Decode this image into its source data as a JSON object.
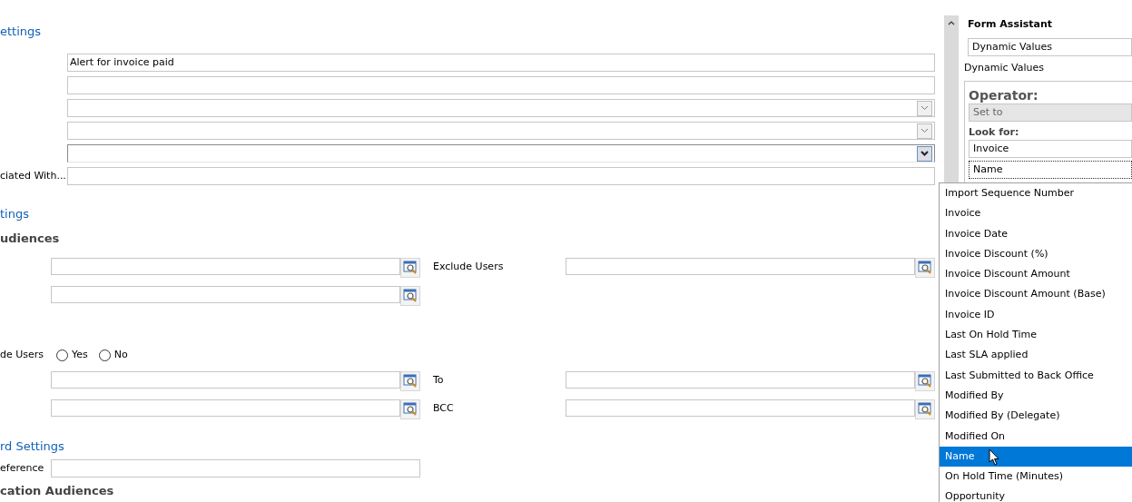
{
  "general": {
    "heading": "ettings",
    "fields": [
      {
        "kind": "text",
        "value": "Alert for invoice paid",
        "focused": false
      },
      {
        "kind": "text",
        "focused": false
      },
      {
        "kind": "select",
        "focused": false
      },
      {
        "kind": "select",
        "focused": false
      },
      {
        "kind": "select",
        "focused": true
      },
      {
        "kind": "text",
        "label": "ciated With...",
        "focused": false
      }
    ]
  },
  "audience_settings": {
    "heading": "tings",
    "subheading": "udiences",
    "lookup_rows": [
      {
        "kind": "double",
        "right_label": "Exclude Users"
      },
      {
        "kind": "single"
      }
    ]
  },
  "include_users": {
    "label": "de Users",
    "options": [
      {
        "label": "Yes",
        "selected": false
      },
      {
        "label": "No",
        "selected": false
      }
    ]
  },
  "recipient_rows": [
    {
      "kind": "double",
      "right_label": "To"
    },
    {
      "kind": "double",
      "right_label": "BCC"
    }
  ],
  "dashboard_settings": {
    "heading": "rd Settings",
    "reference_label": "eference"
  },
  "next_heading": "cation Audiences",
  "form_assistant": {
    "title": "Form Assistant",
    "mode_select": "Dynamic Values",
    "section_label": "Dynamic Values",
    "operator_label": "Operator:",
    "operator_value": "Set to",
    "look_for_label": "Look for:",
    "look_for_value": "Invoice",
    "attribute_value": "Name"
  },
  "attribute_list": [
    {
      "label": "Import Sequence Number",
      "selected": false
    },
    {
      "label": "Invoice",
      "selected": false
    },
    {
      "label": "Invoice Date",
      "selected": false
    },
    {
      "label": "Invoice Discount (%)",
      "selected": false
    },
    {
      "label": "Invoice Discount Amount",
      "selected": false
    },
    {
      "label": "Invoice Discount Amount (Base)",
      "selected": false
    },
    {
      "label": "Invoice ID",
      "selected": false
    },
    {
      "label": "Last On Hold Time",
      "selected": false
    },
    {
      "label": "Last SLA applied",
      "selected": false
    },
    {
      "label": "Last Submitted to Back Office",
      "selected": false
    },
    {
      "label": "Modified By",
      "selected": false
    },
    {
      "label": "Modified By (Delegate)",
      "selected": false
    },
    {
      "label": "Modified On",
      "selected": false
    },
    {
      "label": "Name",
      "selected": true
    },
    {
      "label": "On Hold Time (Minutes)",
      "selected": false
    },
    {
      "label": "Opportunity",
      "selected": false
    }
  ]
}
